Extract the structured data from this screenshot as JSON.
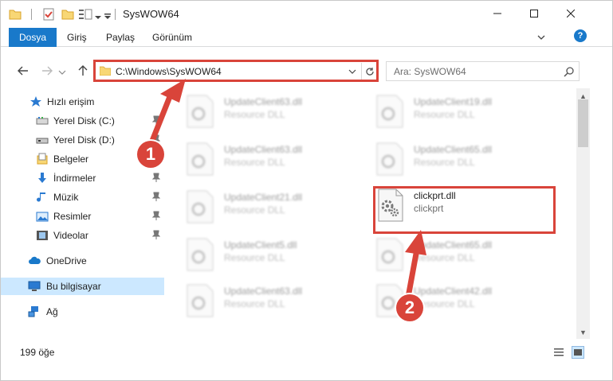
{
  "window": {
    "title": "SysWOW64",
    "minimize_symbol": "—",
    "maximize_symbol": "☐",
    "close_symbol": "✕"
  },
  "ribbon": {
    "tabs": [
      "Dosya",
      "Giriş",
      "Paylaş",
      "Görünüm"
    ],
    "help_symbol": "?",
    "accent_color": "#1979ca"
  },
  "nav": {
    "address": "C:\\Windows\\SysWOW64",
    "search_placeholder": "Ara: SysWOW64"
  },
  "sidebar": {
    "items": [
      {
        "label": "Hızlı erişim",
        "icon": "star-icon",
        "pinned": false
      },
      {
        "label": "Yerel Disk (C:)",
        "icon": "drive-icon",
        "pinned": true
      },
      {
        "label": "Yerel Disk (D:)",
        "icon": "drive-icon",
        "pinned": true
      },
      {
        "label": "Belgeler",
        "icon": "documents-icon",
        "pinned": false
      },
      {
        "label": "İndirmeler",
        "icon": "download-icon",
        "pinned": true
      },
      {
        "label": "Müzik",
        "icon": "music-icon",
        "pinned": true
      },
      {
        "label": "Resimler",
        "icon": "pictures-icon",
        "pinned": true
      },
      {
        "label": "Videolar",
        "icon": "video-icon",
        "pinned": true
      },
      {
        "label": "OneDrive",
        "icon": "cloud-icon",
        "pinned": false
      },
      {
        "label": "Bu bilgisayar",
        "icon": "computer-icon",
        "pinned": false,
        "selected": true
      },
      {
        "label": "Ağ",
        "icon": "network-icon",
        "pinned": false
      }
    ]
  },
  "files": [
    {
      "name": "UpdateClient63.dll",
      "type": "Resource DLL",
      "blurred": true
    },
    {
      "name": "UpdateClient19.dll",
      "type": "Resource DLL",
      "blurred": true
    },
    {
      "name": "UpdateClient63.dll",
      "type": "Resource DLL",
      "blurred": true
    },
    {
      "name": "UpdateClient65.dll",
      "type": "Resource DLL",
      "blurred": true
    },
    {
      "name": "UpdateClient21.dll",
      "type": "Resource DLL",
      "blurred": true
    },
    {
      "name": "clickprt.dll",
      "type": "clickprt",
      "blurred": false
    },
    {
      "name": "UpdateClient5.dll",
      "type": "Resource DLL",
      "blurred": true
    },
    {
      "name": "UpdateClient65.dll",
      "type": "Resource DLL",
      "blurred": true
    },
    {
      "name": "UpdateClient63.dll",
      "type": "Resource DLL",
      "blurred": true
    },
    {
      "name": "UpdateClient42.dll",
      "type": "Resource DLL",
      "blurred": true
    }
  ],
  "status": {
    "item_count": "199 öğe"
  },
  "annotations": {
    "badge_1": "1",
    "badge_2": "2",
    "color": "#d9443a"
  }
}
